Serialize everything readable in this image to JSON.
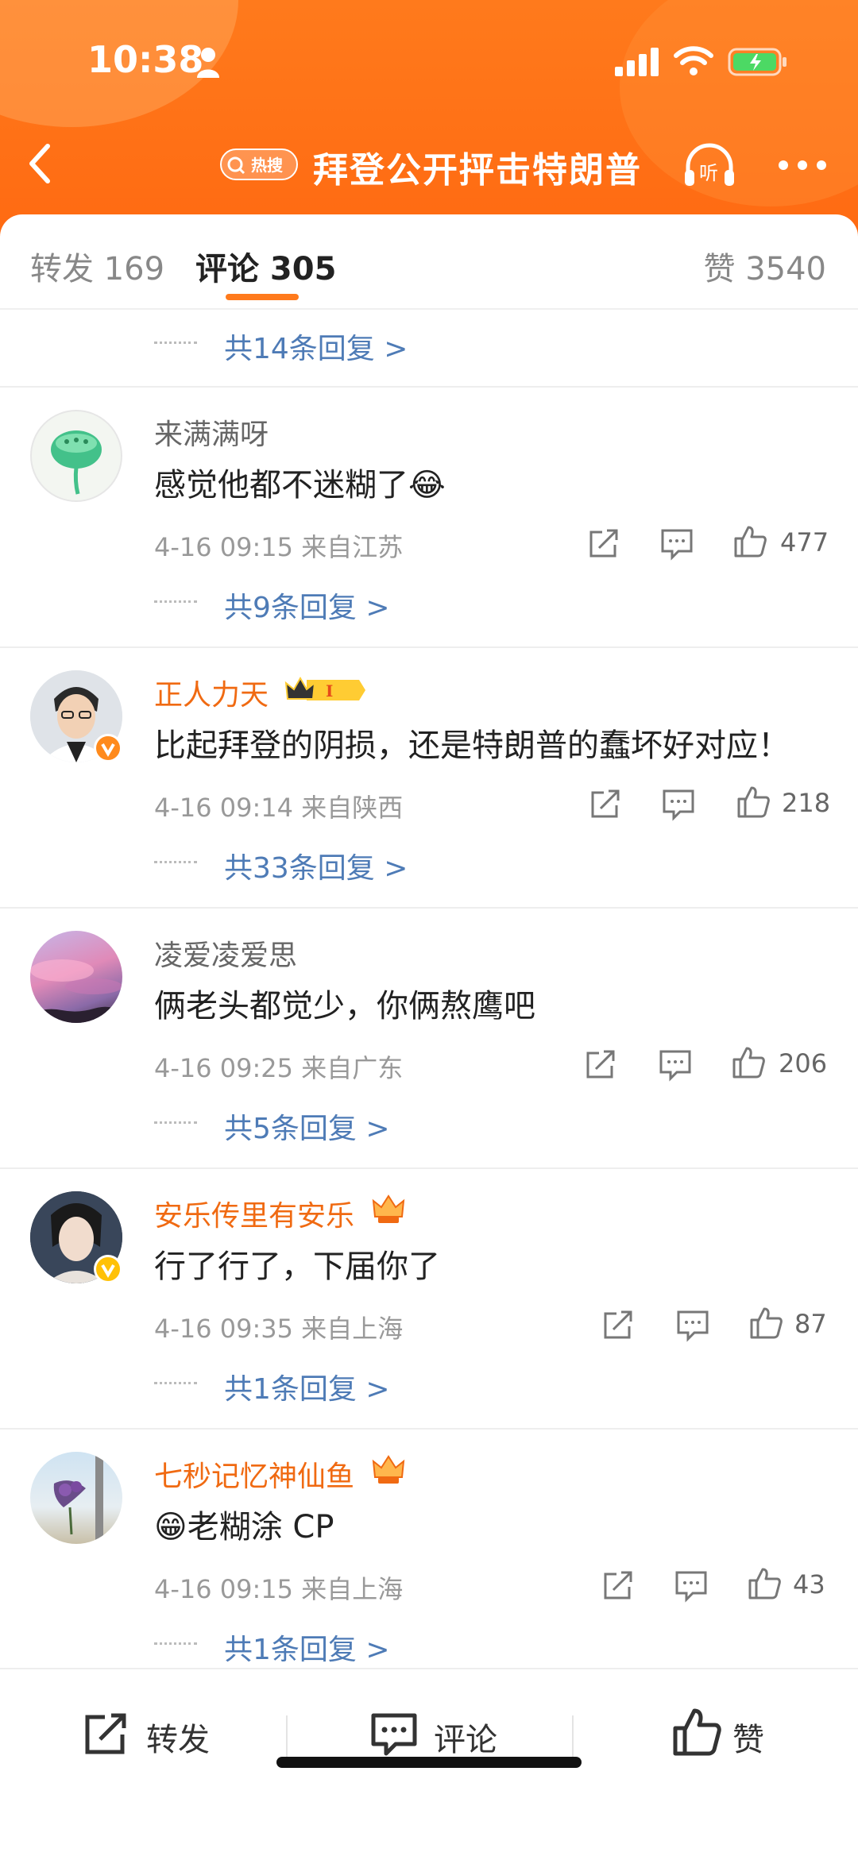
{
  "status": {
    "time": "10:38"
  },
  "nav": {
    "title": "拜登公开抨击特朗普",
    "hot_badge": "热搜"
  },
  "tabs": {
    "repost": "转发 169",
    "comment": "评论 305",
    "like": "赞 3540"
  },
  "top_replies": "共14条回复 >",
  "comments": [
    {
      "user": "来满满呀",
      "text": "感觉他都不迷糊了",
      "emoji": "😂",
      "meta": "4-16 09:15  来自江苏",
      "likes": "477",
      "replies": "共9条回复 >"
    },
    {
      "user": "正人力天",
      "text": "比起拜登的阴损，还是特朗普的蠢坏好对应！",
      "meta": "4-16 09:14  来自陕西",
      "likes": "218",
      "replies": "共33条回复 >"
    },
    {
      "user": "凌爱凌爱思",
      "text": "俩老头都觉少，你俩熬鹰吧",
      "meta": "4-16 09:25  来自广东",
      "likes": "206",
      "replies": "共5条回复 >"
    },
    {
      "user": "安乐传里有安乐",
      "text": "行了行了，下届你了",
      "meta": "4-16 09:35  来自上海",
      "likes": "87",
      "replies": "共1条回复 >"
    },
    {
      "user": "七秒记忆神仙鱼",
      "emoji": "😁",
      "text": "老糊涂 CP",
      "meta": "4-16 09:15  来自上海",
      "likes": "43",
      "replies": "共1条回复 >"
    }
  ],
  "bottom_bar": {
    "repost": "转发",
    "comment": "评论",
    "like": "赞"
  },
  "colors": {
    "accent": "#ff7a1c",
    "link": "#4e7bb6",
    "vip_name": "#f06a12"
  }
}
